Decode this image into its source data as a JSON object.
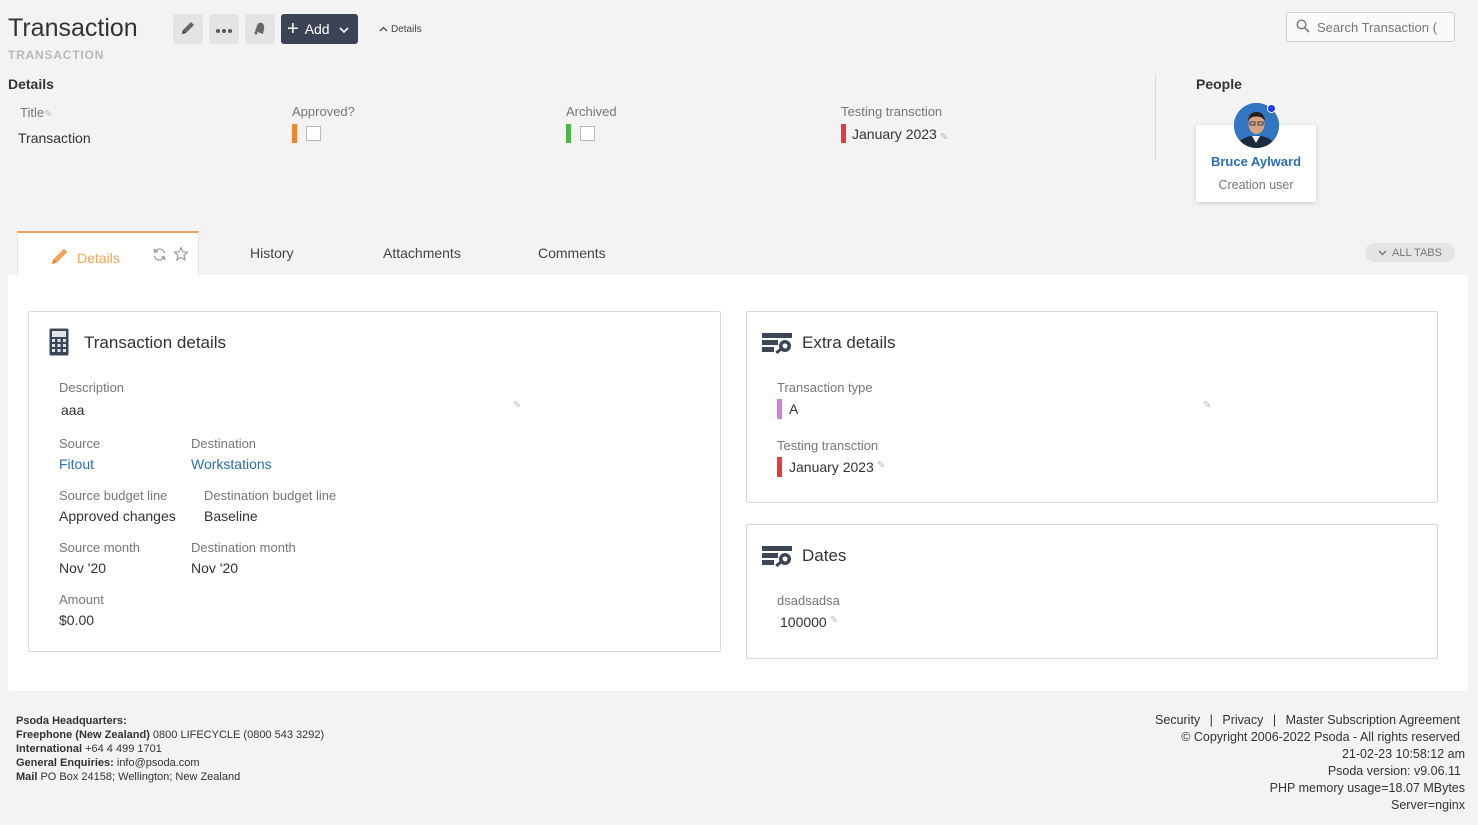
{
  "header": {
    "title": "Transaction",
    "subtitle": "TRANSACTION",
    "add_label": "Add",
    "details_toggle": "Details",
    "search_placeholder": "Search Transaction ("
  },
  "details": {
    "heading": "Details",
    "fields": {
      "title_label": "Title",
      "title_value": "Transaction",
      "approved_label": "Approved?",
      "archived_label": "Archived",
      "testing_label": "Testing transction",
      "testing_value": "January 2023"
    }
  },
  "people": {
    "heading": "People",
    "name": "Bruce Aylward",
    "role": "Creation user"
  },
  "tabs": {
    "details": "Details",
    "history": "History",
    "attachments": "Attachments",
    "comments": "Comments",
    "all_tabs": "ALL TABS"
  },
  "transaction_details": {
    "title": "Transaction details",
    "description_label": "Description",
    "description_value": "aaa",
    "source_label": "Source",
    "source_value": "Fitout",
    "destination_label": "Destination",
    "destination_value": "Workstations",
    "source_budget_label": "Source budget line",
    "source_budget_value": "Approved changes",
    "dest_budget_label": "Destination budget line",
    "dest_budget_value": "Baseline",
    "source_month_label": "Source month",
    "source_month_value": "Nov '20",
    "dest_month_label": "Destination month",
    "dest_month_value": "Nov '20",
    "amount_label": "Amount",
    "amount_value": "$0.00"
  },
  "extra_details": {
    "title": "Extra details",
    "type_label": "Transaction type",
    "type_value": "A",
    "testing_label": "Testing transction",
    "testing_value": "January 2023"
  },
  "dates": {
    "title": "Dates",
    "field_label": "dsadsadsa",
    "field_value": "100000"
  },
  "footer": {
    "hq_label": "Psoda Headquarters:",
    "freephone_label": "Freephone (New Zealand)",
    "freephone_value": "0800 LIFECYCLE (0800 543 3292)",
    "international_label": "International",
    "international_value": "+64 4 499 1701",
    "enquiries_label": "General Enquiries:",
    "enquiries_value": "info@psoda.com",
    "mail_label": "Mail",
    "mail_value": "PO Box 24158; Wellington; New Zealand",
    "security": "Security",
    "privacy": "Privacy",
    "msa": "Master Subscription Agreement",
    "separator": "|",
    "copyright": "© Copyright 2006-2022 Psoda - All rights reserved",
    "datetime": "21-02-23 10:58:12 am",
    "version": "Psoda version: v9.06.11",
    "memory": "PHP memory usage=18.07 MBytes",
    "server": "Server=nginx"
  },
  "colors": {
    "approved_bar": "#f0842c",
    "archived_bar": "#4cb84c",
    "testing_bar": "#e53b3b",
    "type_bar": "#d27ce8",
    "active_tab": "#f1a45a",
    "link": "#2a6fb5",
    "add_button": "#3a4454"
  }
}
